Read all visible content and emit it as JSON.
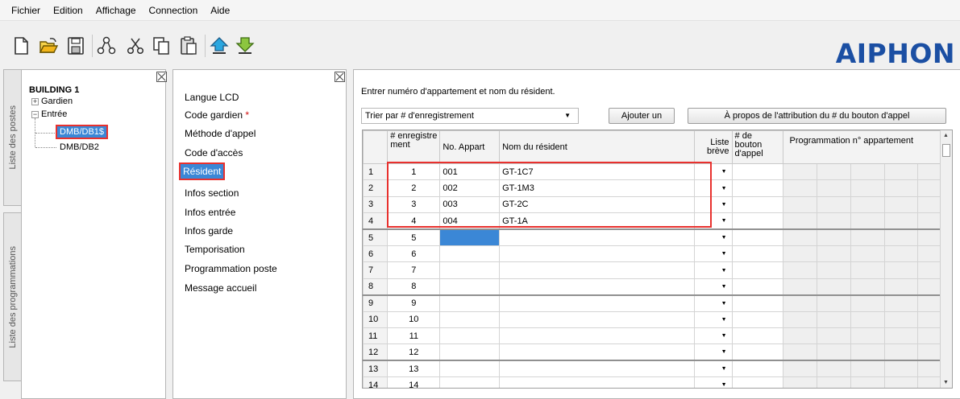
{
  "menubar": {
    "items": [
      "Fichier",
      "Edition",
      "Affichage",
      "Connection",
      "Aide"
    ]
  },
  "toolbar": {
    "icons": [
      "new-file-icon",
      "open-folder-icon",
      "save-icon",
      "network-icon",
      "cut-icon",
      "copy-icon",
      "paste-icon",
      "upload-icon",
      "download-icon"
    ],
    "brand": "AIPHON",
    "brand_color": "#1b4fa3"
  },
  "side_tabs": {
    "stations": "Liste des postes",
    "programs": "Liste des programmations"
  },
  "tree": {
    "root": "BUILDING 1",
    "guard": "Gardien",
    "entrance": "Entrée",
    "children": [
      "DMB/DB1$",
      "DMB/DB2"
    ]
  },
  "settings": {
    "items": [
      "Langue LCD",
      "Code gardien",
      "Méthode d'appel",
      "Code d'accès",
      "Résident",
      "Infos section",
      "Infos entrée",
      "Infos garde",
      "Temporisation",
      "Programmation poste",
      "Message accueil"
    ],
    "required_mark": "*",
    "selected": "Résident"
  },
  "main": {
    "instruction": "Entrer numéro d'appartement et nom du résident.",
    "sort_value": "Trier par # d'enregistrement",
    "add_button": "Ajouter un",
    "about_button": "À propos de l'attribution du # du bouton d'appel",
    "columns": {
      "reg": "# enregistre ment",
      "apt": "No. Appart",
      "name": "Nom du résident",
      "short": "Liste brève",
      "callbtn": "# de bouton d'appel",
      "prog": "Programmation n° appartement"
    },
    "rows": [
      {
        "n": "1",
        "reg": "1",
        "apt": "001",
        "name": "GT-1C7"
      },
      {
        "n": "2",
        "reg": "2",
        "apt": "002",
        "name": "GT-1M3"
      },
      {
        "n": "3",
        "reg": "3",
        "apt": "003",
        "name": "GT-2C"
      },
      {
        "n": "4",
        "reg": "4",
        "apt": "004",
        "name": "GT-1A"
      },
      {
        "n": "5",
        "reg": "5",
        "apt": "",
        "name": ""
      },
      {
        "n": "6",
        "reg": "6",
        "apt": "",
        "name": ""
      },
      {
        "n": "7",
        "reg": "7",
        "apt": "",
        "name": ""
      },
      {
        "n": "8",
        "reg": "8",
        "apt": "",
        "name": ""
      },
      {
        "n": "9",
        "reg": "9",
        "apt": "",
        "name": ""
      },
      {
        "n": "10",
        "reg": "10",
        "apt": "",
        "name": ""
      },
      {
        "n": "11",
        "reg": "11",
        "apt": "",
        "name": ""
      },
      {
        "n": "12",
        "reg": "12",
        "apt": "",
        "name": ""
      },
      {
        "n": "13",
        "reg": "13",
        "apt": "",
        "name": ""
      },
      {
        "n": "14",
        "reg": "14",
        "apt": "",
        "name": ""
      }
    ],
    "highlight_color": "#e8312e",
    "selection_color": "#3b87d6"
  }
}
